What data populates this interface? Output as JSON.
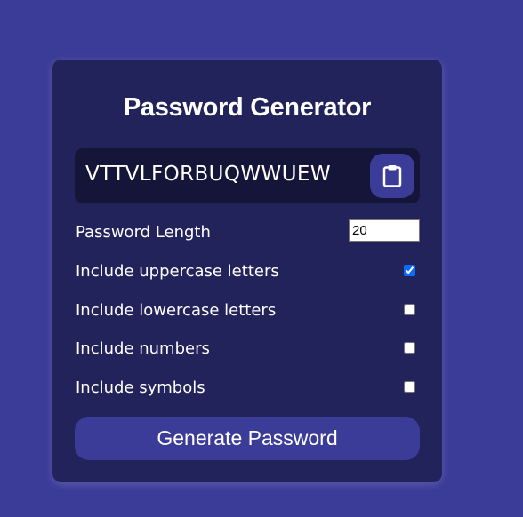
{
  "app": {
    "title": "Password Generator"
  },
  "result": {
    "password": "VTTVLFORBUQWWUEW",
    "copy_icon": "clipboard-icon"
  },
  "settings": {
    "length": {
      "label": "Password Length",
      "value": "20"
    },
    "uppercase": {
      "label": "Include uppercase letters",
      "checked": true
    },
    "lowercase": {
      "label": "Include lowercase letters",
      "checked": false
    },
    "numbers": {
      "label": "Include numbers",
      "checked": false
    },
    "symbols": {
      "label": "Include symbols",
      "checked": false
    }
  },
  "actions": {
    "generate_label": "Generate Password"
  },
  "colors": {
    "background": "#3b3b98",
    "card": "#23235b",
    "result_box": "#15153a",
    "checkbox_accent": "#0a6cff"
  }
}
